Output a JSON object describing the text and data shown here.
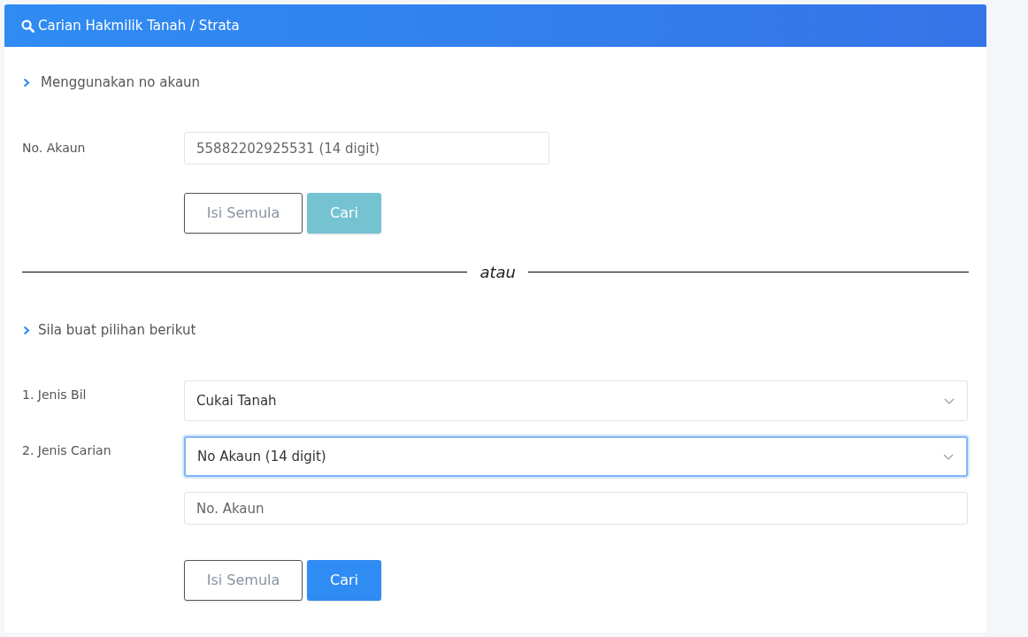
{
  "header": {
    "title": "Carian Hakmilik Tanah / Strata"
  },
  "section_account": {
    "heading": "Menggunakan no akaun",
    "field": {
      "label": "No. Akaun",
      "placeholder": "55882202925531 (14 digit)"
    },
    "buttons": [
      {
        "label": "Isi Semula",
        "kind": "reset",
        "disabled": false
      },
      {
        "label": "Cari",
        "kind": "submit",
        "disabled": true
      }
    ]
  },
  "divider": {
    "label": "atau"
  },
  "section_options": {
    "heading": "Sila buat pilihan berikut",
    "selects": [
      {
        "label": "1. Jenis Bil",
        "value": "Cukai Tanah",
        "focused": false
      },
      {
        "label": "2. Jenis Carian",
        "value": "No Akaun (14 digit)",
        "focused": true
      }
    ],
    "field": {
      "placeholder": "No. Akaun"
    },
    "buttons": [
      {
        "label": "Isi Semula",
        "kind": "reset",
        "disabled": false
      },
      {
        "label": "Cari",
        "kind": "submit",
        "disabled": false
      }
    ]
  }
}
